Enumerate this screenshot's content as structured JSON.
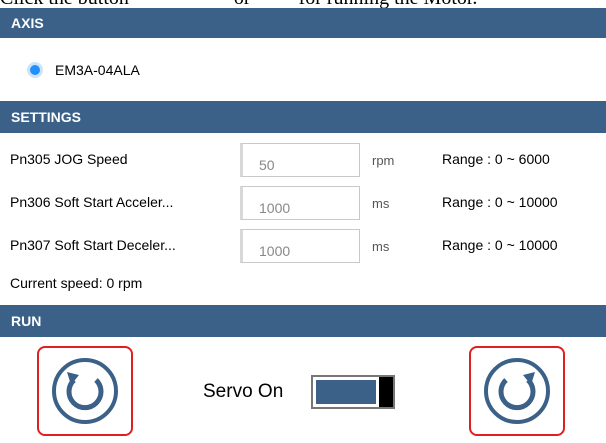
{
  "caption": {
    "left": "Click the button",
    "middle": "or",
    "right": "for running the Motor."
  },
  "axis": {
    "header": "AXIS",
    "selected_axis": "EM3A-04ALA"
  },
  "settings": {
    "header": "SETTINGS",
    "rows": [
      {
        "name": "Pn305 JOG Speed",
        "value": "50",
        "unit": "rpm",
        "range": "Range :  0  ~  6000"
      },
      {
        "name": "Pn306 Soft Start Acceler...",
        "value": "1000",
        "unit": "ms",
        "range": "Range :  0  ~  10000"
      },
      {
        "name": "Pn307 Soft Start Deceler...",
        "value": "1000",
        "unit": "ms",
        "range": "Range :  0  ~  10000"
      }
    ],
    "current_speed": "Current speed: 0 rpm"
  },
  "run": {
    "header": "RUN",
    "servo_label": "Servo On",
    "servo_on": true
  },
  "colors": {
    "bar": "#3b6189",
    "highlight": "#e02020",
    "radio": "#1e90ff"
  }
}
